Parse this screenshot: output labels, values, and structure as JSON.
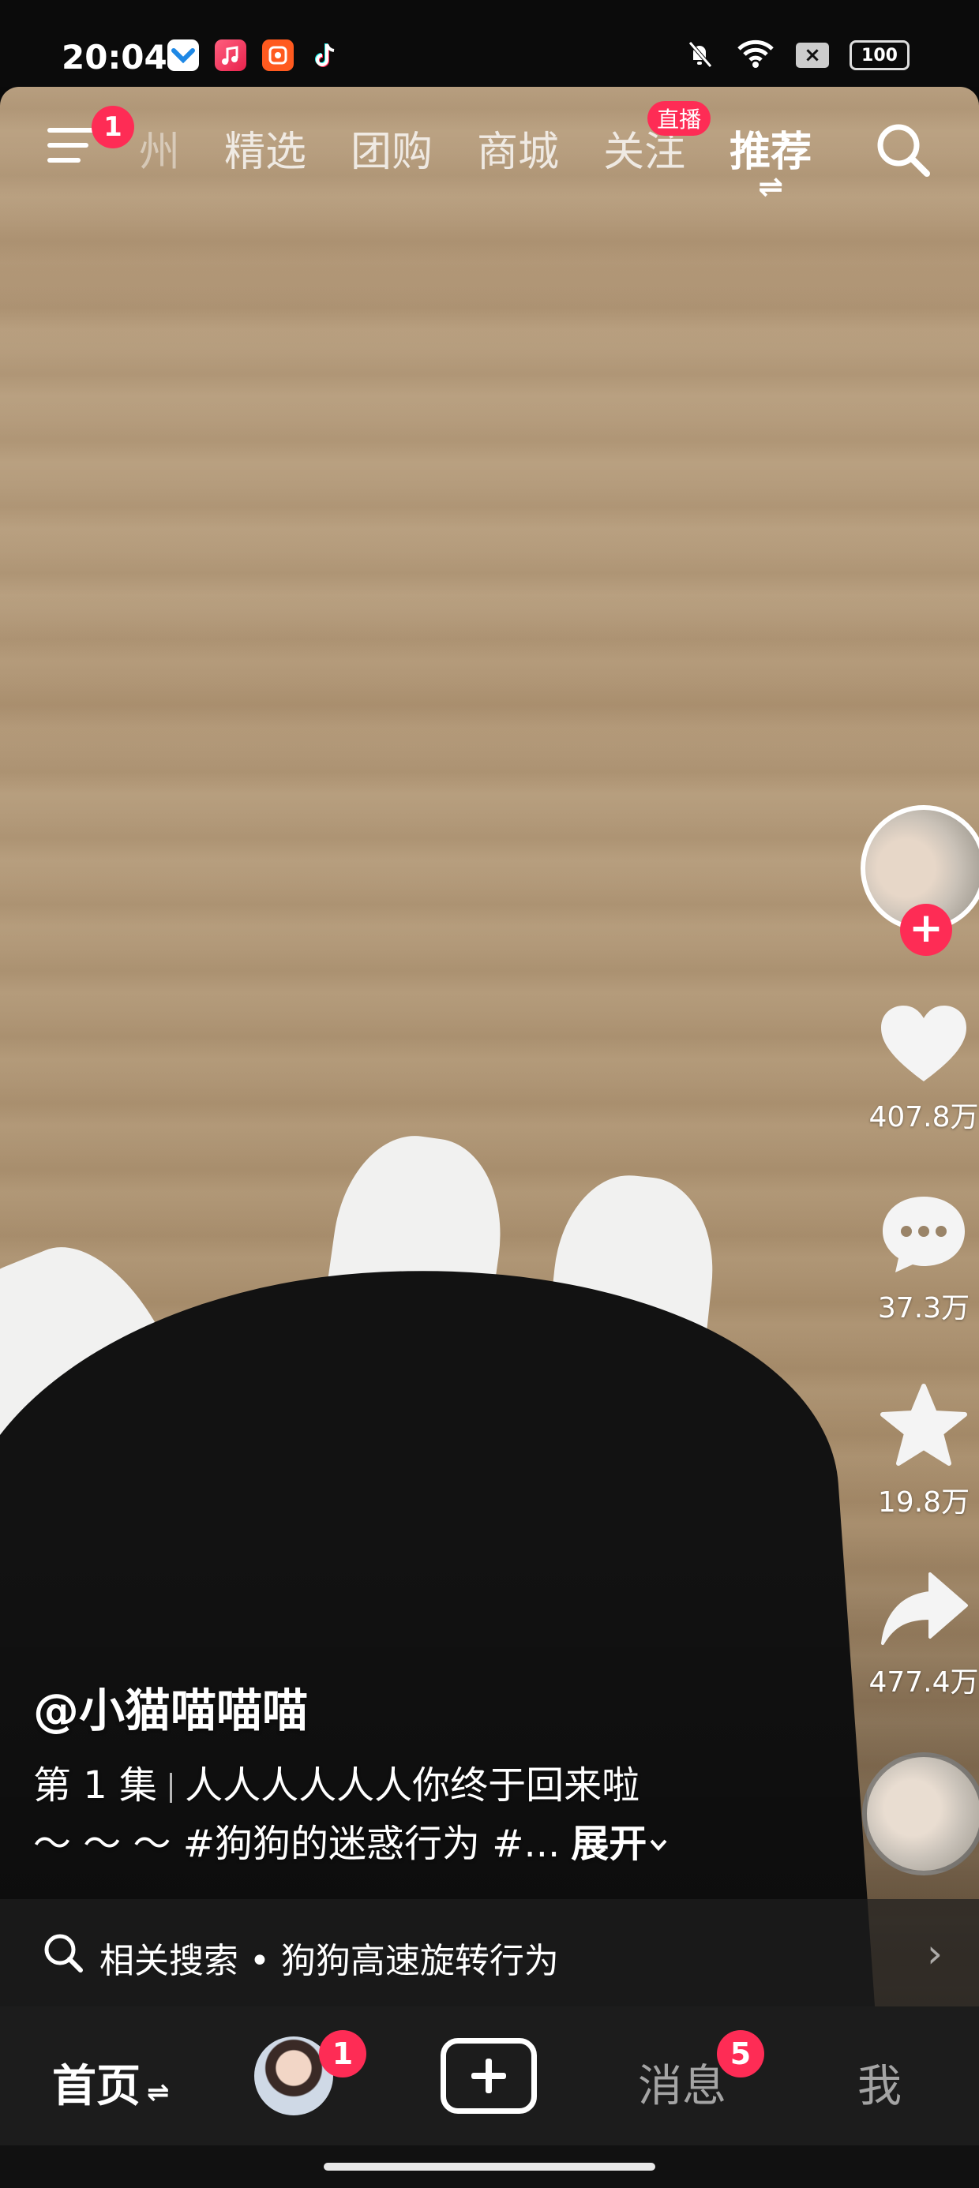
{
  "status_bar": {
    "time": "20:04",
    "battery": "100",
    "icons": [
      "app-icon-blue",
      "music-app-icon",
      "orange-app-icon",
      "tiktok-icon",
      "mute-bell-icon",
      "wifi-icon",
      "close-box-icon",
      "battery-icon"
    ]
  },
  "top_nav": {
    "menu_badge": "1",
    "tabs": [
      {
        "label": "州"
      },
      {
        "label": "精选"
      },
      {
        "label": "团购"
      },
      {
        "label": "商城"
      },
      {
        "label": "关注",
        "tag": "直播"
      },
      {
        "label": "推荐",
        "switch_mark": "⇌"
      }
    ]
  },
  "right_rail": {
    "follow_plus": "+",
    "likes": "407.8万",
    "comments": "37.3万",
    "favorites": "19.8万",
    "shares": "477.4万"
  },
  "caption": {
    "author": "@小猫喵喵喵",
    "episode": "第 1 集",
    "line1_text": "人人人人人人你终于回来啦",
    "line2_text": "～ ～ ～ #狗狗的迷惑行为 #...",
    "expand": "展开"
  },
  "related_search": {
    "text": "相关搜索 • 狗狗高速旋转行为",
    "arrow": "›"
  },
  "bottom_nav": {
    "home": "首页",
    "home_switch": "⇌",
    "avatar_badge": "1",
    "messages": "消息",
    "messages_badge": "5",
    "me": "我"
  },
  "colors": {
    "accent": "#fe2c55",
    "bottom_nav_bg": "#1c1c1c",
    "floor": "#b39a7a"
  }
}
